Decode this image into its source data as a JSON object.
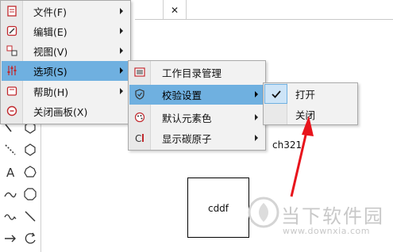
{
  "document": {
    "close_glyph": "✕"
  },
  "main_menu": {
    "items": [
      {
        "label": "文件(F)",
        "icon": "file-icon",
        "has_submenu": true
      },
      {
        "label": "编辑(E)",
        "icon": "edit-icon",
        "has_submenu": true
      },
      {
        "label": "视图(V)",
        "icon": "view-icon",
        "has_submenu": true
      },
      {
        "label": "选项(S)",
        "icon": "options-icon",
        "has_submenu": true,
        "highlighted": true
      },
      {
        "label": "帮助(H)",
        "icon": "help-icon",
        "has_submenu": true
      },
      {
        "label": "关闭画板(X)",
        "icon": "close-board-icon",
        "has_submenu": false
      }
    ]
  },
  "options_menu": {
    "items": [
      {
        "label": "工作目录管理",
        "icon": "directory-icon",
        "has_submenu": false
      },
      {
        "label": "校验设置",
        "icon": "shield-icon",
        "has_submenu": true,
        "highlighted": true
      },
      {
        "label": "默认元素色",
        "icon": "palette-icon",
        "has_submenu": true
      },
      {
        "label": "显示碳原子",
        "icon": "carbon-icon",
        "has_submenu": true
      }
    ]
  },
  "check_menu": {
    "items": [
      {
        "label": "打开",
        "checked": true
      },
      {
        "label": "关闭",
        "checked": false
      }
    ]
  },
  "canvas": {
    "box_label": "cddf",
    "molecule_label": "ch321"
  },
  "watermark": {
    "text": "当下软件园",
    "url": "www.downxia.com"
  },
  "colors": {
    "highlight": "#6fb0e0",
    "annotation_arrow": "#e8141c",
    "menu_bg": "#f2f2f2"
  }
}
